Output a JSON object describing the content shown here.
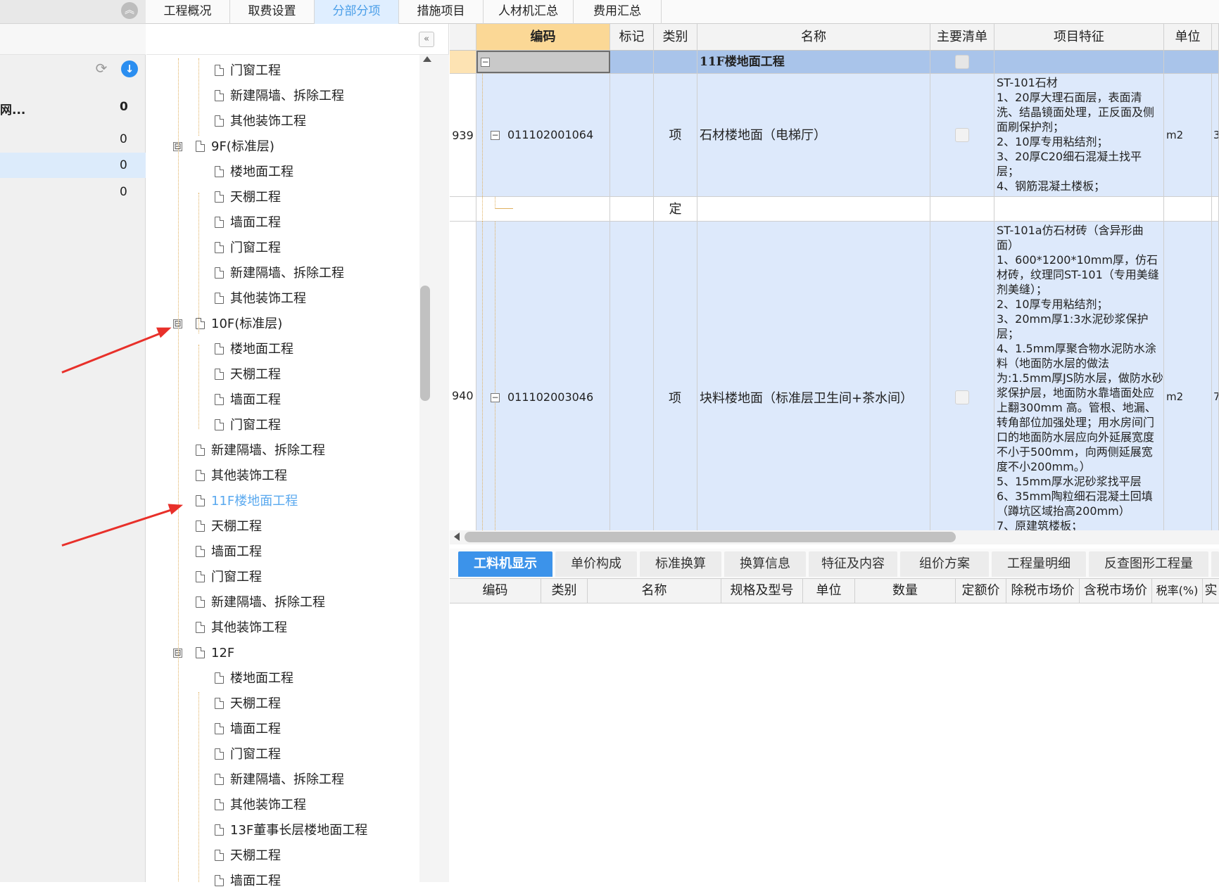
{
  "left_panel": {
    "rows": [
      {
        "label": "网...",
        "value": "0"
      },
      {
        "label": "",
        "value": "0"
      },
      {
        "label": "",
        "value": "0"
      },
      {
        "label": "",
        "value": "0"
      }
    ]
  },
  "tabs": [
    "工程概况",
    "取费设置",
    "分部分项",
    "措施项目",
    "人材机汇总",
    "费用汇总"
  ],
  "active_tab": "分部分项",
  "tree": [
    {
      "label": "门窗工程",
      "level": 2
    },
    {
      "label": "新建隔墙、拆除工程",
      "level": 2
    },
    {
      "label": "其他装饰工程",
      "level": 2
    },
    {
      "label": "9F(标准层)",
      "level": 1,
      "toggle": "⊟"
    },
    {
      "label": "楼地面工程",
      "level": 2
    },
    {
      "label": "天棚工程",
      "level": 2
    },
    {
      "label": "墙面工程",
      "level": 2
    },
    {
      "label": "门窗工程",
      "level": 2
    },
    {
      "label": "新建隔墙、拆除工程",
      "level": 2
    },
    {
      "label": "其他装饰工程",
      "level": 2
    },
    {
      "label": "10F(标准层)",
      "level": 1,
      "toggle": "⊟"
    },
    {
      "label": "楼地面工程",
      "level": 2
    },
    {
      "label": "天棚工程",
      "level": 2
    },
    {
      "label": "墙面工程",
      "level": 2
    },
    {
      "label": "门窗工程",
      "level": 2
    },
    {
      "label": "新建隔墙、拆除工程",
      "level": 1
    },
    {
      "label": "其他装饰工程",
      "level": 1
    },
    {
      "label": "11F楼地面工程",
      "level": 1,
      "selected": true
    },
    {
      "label": "天棚工程",
      "level": 1
    },
    {
      "label": "墙面工程",
      "level": 1
    },
    {
      "label": "门窗工程",
      "level": 1
    },
    {
      "label": "新建隔墙、拆除工程",
      "level": 1
    },
    {
      "label": "其他装饰工程",
      "level": 1
    },
    {
      "label": "12F",
      "level": 1,
      "toggle": "⊟"
    },
    {
      "label": "楼地面工程",
      "level": 2
    },
    {
      "label": "天棚工程",
      "level": 2
    },
    {
      "label": "墙面工程",
      "level": 2
    },
    {
      "label": "门窗工程",
      "level": 2
    },
    {
      "label": "新建隔墙、拆除工程",
      "level": 2
    },
    {
      "label": "其他装饰工程",
      "level": 2
    },
    {
      "label": "13F董事长层楼地面工程",
      "level": 2
    },
    {
      "label": "天棚工程",
      "level": 2
    },
    {
      "label": "墙面工程",
      "level": 2
    }
  ],
  "grid": {
    "headers": [
      "编码",
      "标记",
      "类别",
      "名称",
      "主要清单",
      "项目特征",
      "单位"
    ],
    "section_row": {
      "toggle": "−",
      "name": "11F楼地面工程"
    },
    "rows": [
      {
        "index": "939",
        "code": "011102001064",
        "type": "项",
        "name": "石材楼地面（电梯厅）",
        "feature": "ST-101石材\n1、20厚大理石面层，表面清洗、结晶镜面处理，正反面及侧面刷保护剂；\n2、10厚专用粘结剂；\n3、20厚C20细石混凝土找平层；\n4、钢筋混凝土楼板；",
        "unit": "m2",
        "extra": "3"
      },
      {
        "index": "",
        "code": "",
        "type": "定",
        "name": "",
        "feature": "",
        "unit": "",
        "extra": ""
      },
      {
        "index": "940",
        "code": "011102003046",
        "type": "项",
        "name": "块料楼地面（标准层卫生间+茶水间）",
        "feature": "ST-101a仿石材砖（含异形曲面）\n1、600*1200*10mm厚，仿石材砖，纹理同ST-101（专用美缝剂美缝）；\n2、10厚专用粘结剂；\n3、20mm厚1:3水泥砂浆保护层；\n4、1.5mm厚聚合物水泥防水涂料（地面防水层的做法为:1.5mm厚JS防水层，做防水砂浆保护层，地面防水靠墙面处应上翻300mm 高。管根、地漏、转角部位加强处理；用水房间门口的地面防水层应向外延展宽度不小于500mm，向两侧延展宽度不小200mm。）\n5、15mm厚水泥砂浆找平层\n6、35mm陶粒细石混凝土回填（蹲坑区域抬高200mm）\n7、原建筑楼板；",
        "unit": "m2",
        "extra": "7"
      }
    ]
  },
  "bottom_tabs": [
    "工料机显示",
    "单价构成",
    "标准换算",
    "换算信息",
    "特征及内容",
    "组价方案",
    "工程量明细",
    "反查图形工程量"
  ],
  "active_bottom_tab": "工料机显示",
  "sub_headers": [
    "编码",
    "类别",
    "名称",
    "规格及型号",
    "单位",
    "数量",
    "定额价",
    "除税市场价",
    "含税市场价",
    "税率(%)",
    "实"
  ],
  "colors": {
    "accent": "#3c93ea",
    "header_code": "#fbd896",
    "row_bg": "#dde9fb",
    "arrow": "#e8302a"
  }
}
